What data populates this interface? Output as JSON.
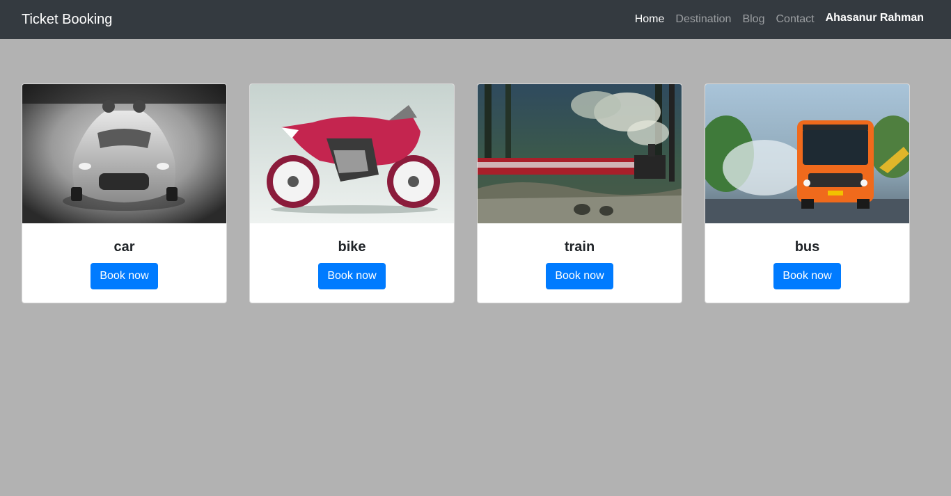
{
  "navbar": {
    "brand": "Ticket Booking",
    "links": [
      {
        "label": "Home",
        "active": true
      },
      {
        "label": "Destination",
        "active": false
      },
      {
        "label": "Blog",
        "active": false
      },
      {
        "label": "Contact",
        "active": false
      }
    ],
    "user_name": "Ahasanur Rahman"
  },
  "vehicles": [
    {
      "title": "car",
      "button_label": "Book now",
      "image": "car-photo"
    },
    {
      "title": "bike",
      "button_label": "Book now",
      "image": "motorbike-photo"
    },
    {
      "title": "train",
      "button_label": "Book now",
      "image": "steam-train-photo"
    },
    {
      "title": "bus",
      "button_label": "Book now",
      "image": "bus-photo"
    }
  ],
  "colors": {
    "navbar_bg": "#343a40",
    "page_bg": "#b2b2b2",
    "button_bg": "#007bff"
  }
}
